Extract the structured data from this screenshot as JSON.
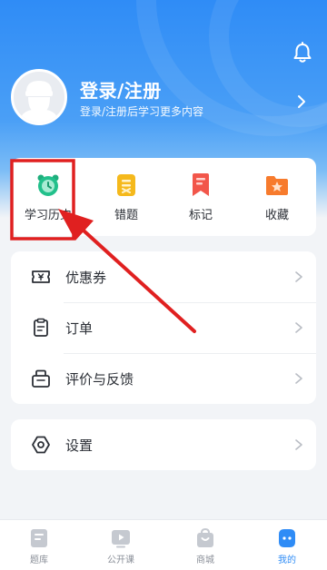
{
  "header": {
    "login_title": "登录/注册",
    "login_subtitle": "登录/注册后学习更多内容",
    "bell_icon": "bell-icon",
    "avatar_icon": "default-avatar"
  },
  "quick_actions": [
    {
      "label": "学习历史",
      "icon": "alarm-clock-icon",
      "color": "#22c08b"
    },
    {
      "label": "错题",
      "icon": "wrong-question-icon",
      "color": "#f5b91c"
    },
    {
      "label": "标记",
      "icon": "bookmark-icon",
      "color": "#f2564a"
    },
    {
      "label": "收藏",
      "icon": "star-folder-icon",
      "color": "#f77b2d"
    }
  ],
  "menu_group_1": [
    {
      "label": "优惠券",
      "icon": "coupon-icon"
    },
    {
      "label": "订单",
      "icon": "order-icon"
    },
    {
      "label": "评价与反馈",
      "icon": "feedback-icon"
    }
  ],
  "menu_group_2": [
    {
      "label": "设置",
      "icon": "settings-icon"
    }
  ],
  "tabbar": [
    {
      "label": "题库",
      "icon": "question-bank-icon",
      "active": false
    },
    {
      "label": "公开课",
      "icon": "open-course-icon",
      "active": false
    },
    {
      "label": "商城",
      "icon": "shop-icon",
      "active": false
    },
    {
      "label": "我的",
      "icon": "mine-icon",
      "active": true
    }
  ],
  "colors": {
    "primary": "#2f8cf6",
    "annotation_red": "#e02020",
    "text": "#2b2f36",
    "tab_inactive": "#8a8f98"
  }
}
